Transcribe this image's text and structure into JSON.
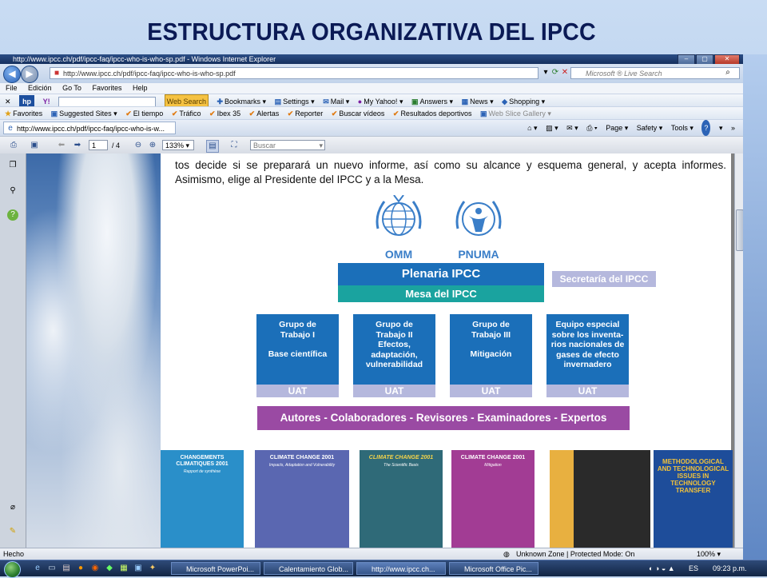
{
  "slide": {
    "title": "ESTRUCTURA ORGANIZATIVA DEL IPCC"
  },
  "window": {
    "title": "http://www.ipcc.ch/pdf/ipcc-faq/ipcc-who-is-who-sp.pdf - Windows Internet Explorer",
    "buttons": {
      "minimize": "–",
      "maximize": "▢",
      "close": "✕"
    }
  },
  "address": {
    "url": "http://www.ipcc.ch/pdf/ipcc-faq/ipcc-who-is-who-sp.pdf",
    "search_placeholder": "Microsoft ® Live Search"
  },
  "menu": [
    "File",
    "Edición",
    "Go To",
    "Favorites",
    "Help"
  ],
  "yahoo_toolbar": {
    "web_search": "Web Search",
    "items": [
      "Bookmarks",
      "Settings",
      "Mail",
      "My Yahoo!",
      "Answers",
      "News",
      "Shopping"
    ]
  },
  "favorites_bar": {
    "label": "Favorites",
    "items": [
      "Suggested Sites",
      "El tiempo",
      "Tráfico",
      "Ibex 35",
      "Alertas",
      "Reporter",
      "Buscar vídeos",
      "Resultados deportivos",
      "Web Slice Gallery"
    ]
  },
  "tab": {
    "label": "http://www.ipcc.ch/pdf/ipcc-faq/ipcc-who-is-w..."
  },
  "command_bar": {
    "page": "Page",
    "safety": "Safety",
    "tools": "Tools",
    "help": "?"
  },
  "pdf_toolbar": {
    "page_value": "1",
    "page_total": "/ 4",
    "zoom": "133%",
    "find_placeholder": "Buscar"
  },
  "document": {
    "paragraph": "tos decide si se preparará un nuevo informe, así como su alcance y esquema general, y acepta informes. Asimismo, elige al Presidente del IPCC y a la Mesa.",
    "logos": {
      "omm": "OMM",
      "pnuma": "PNUMA"
    },
    "plenaria": "Plenaria IPCC",
    "mesa": "Mesa del IPCC",
    "secretaria": "Secretaría del IPCC",
    "groups": [
      {
        "lines": [
          "Grupo de",
          "Trabajo I",
          "",
          "Base científica"
        ],
        "uat": "UAT"
      },
      {
        "lines": [
          "Grupo de",
          "Trabajo II",
          "Efectos,",
          "adaptación,",
          "vulnerabilidad"
        ],
        "uat": "UAT"
      },
      {
        "lines": [
          "Grupo de",
          "Trabajo III",
          "",
          "Mitigación"
        ],
        "uat": "UAT"
      },
      {
        "lines": [
          "Equipo especial",
          "sobre los inventa-",
          "rios nacionales de",
          "gases de efecto",
          "invernadero"
        ],
        "uat": "UAT"
      }
    ],
    "autores": "Autores - Colaboradores - Revisores - Examinadores - Expertos",
    "covers": [
      {
        "title": "CHANGEMENTS CLIMATIQUES 2001",
        "subtitle": "Rapport de synthèse",
        "color": "#2a8fc9"
      },
      {
        "title": "CLIMATE CHANGE 2001",
        "subtitle": "Impacts, Adaptation and Vulnerability",
        "color": "#5a67b1"
      },
      {
        "title": "CLIMATE CHANGE 2001",
        "subtitle": "The Scientific Basis",
        "color": "#2f6a78"
      },
      {
        "title": "CLIMATE CHANGE 2001",
        "subtitle": "Mitigation",
        "color": "#a23c94"
      },
      {
        "title": "",
        "subtitle": "",
        "color": "#e8b040"
      },
      {
        "title": "",
        "subtitle": "",
        "color": "#2a2a2a"
      },
      {
        "title": "METHODOLOGICAL AND TECHNOLOGICAL ISSUES IN TECHNOLOGY TRANSFER",
        "subtitle": "",
        "color": "#1e4d9a"
      }
    ]
  },
  "status": {
    "left": "Hecho",
    "zone": "Unknown Zone | Protected Mode: On",
    "zoom": "100%"
  },
  "taskbar": {
    "buttons": [
      "Microsoft PowerPoi...",
      "Calentamiento Glob...",
      "http://www.ipcc.ch...",
      "Microsoft Office Pic..."
    ],
    "lang": "ES",
    "clock": "09:23 p.m."
  }
}
